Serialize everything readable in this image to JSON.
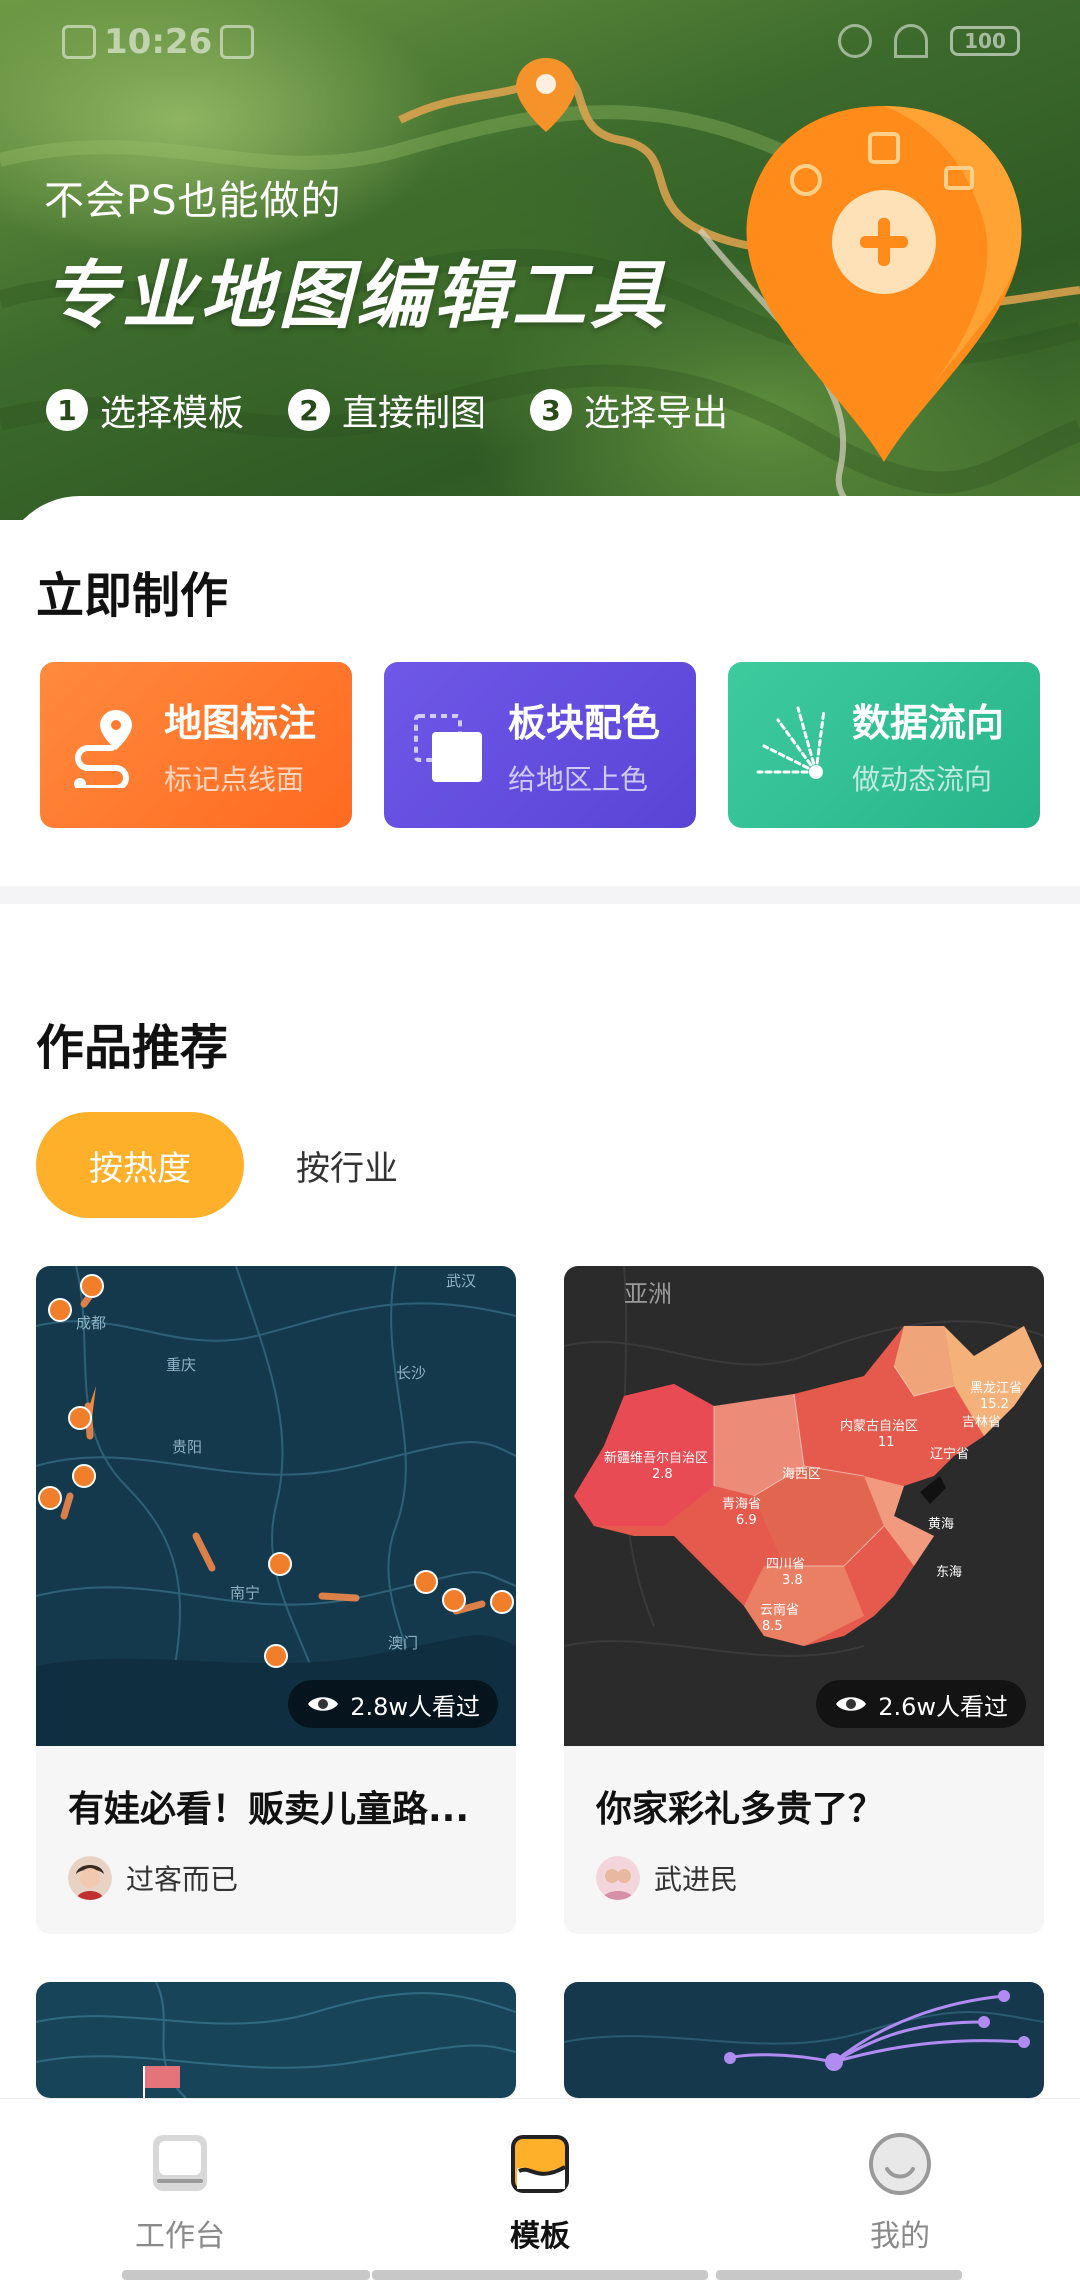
{
  "status_bar": {
    "time": "10:26",
    "battery": "100"
  },
  "hero": {
    "subtitle": "不会PS也能做的",
    "title": "专业地图编辑工具",
    "steps": [
      {
        "num": "1",
        "label": "选择模板"
      },
      {
        "num": "2",
        "label": "直接制图"
      },
      {
        "num": "3",
        "label": "选择导出"
      }
    ]
  },
  "quick_make": {
    "title": "立即制作",
    "tools": [
      {
        "name": "地图标注",
        "desc": "标记点线面",
        "color": "#ff7a2e"
      },
      {
        "name": "板块配色",
        "desc": "给地区上色",
        "color": "#6450e0"
      },
      {
        "name": "数据流向",
        "desc": "做动态流向",
        "color": "#33c195"
      }
    ]
  },
  "recommend": {
    "title": "作品推荐",
    "tabs": [
      "按热度",
      "按行业"
    ],
    "active_tab": "按热度",
    "cards": [
      {
        "title": "有娃必看！贩卖儿童路...",
        "views": "2.8w人看过",
        "author": "过客而已",
        "map_labels": [
          "武汉",
          "成都",
          "重庆",
          "长沙",
          "贵阳",
          "南宁",
          "澳门"
        ]
      },
      {
        "title": "你家彩礼多贵了？",
        "views": "2.6w人看过",
        "author": "武进民",
        "map_labels": [
          "亚洲",
          "新疆维吾尔自治区",
          "2.8",
          "内蒙古自治区",
          "11",
          "黑龙江省",
          "15.2",
          "吉林省",
          "辽宁省",
          "青海省",
          "6.9",
          "四川省",
          "3.8",
          "云南省",
          "8.5",
          "黄海",
          "东海",
          "海西区"
        ]
      }
    ]
  },
  "tabbar": {
    "items": [
      {
        "label": "工作台",
        "icon": "workbench-icon"
      },
      {
        "label": "模板",
        "icon": "template-icon"
      },
      {
        "label": "我的",
        "icon": "profile-icon"
      }
    ],
    "active": "模板"
  },
  "colors": {
    "accent": "#ffb02a",
    "orange": "#ff7a2e",
    "purple": "#6450e0",
    "green": "#33c195"
  }
}
